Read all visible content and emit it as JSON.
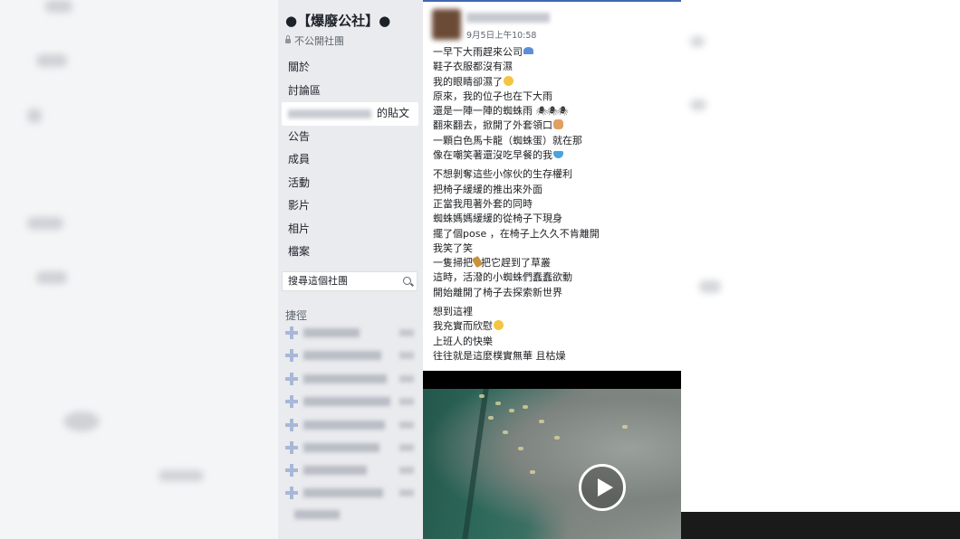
{
  "group": {
    "title": "●【爆廢公社】●",
    "privacy": "不公開社團"
  },
  "sidebar": {
    "items": [
      {
        "label": "關於"
      },
      {
        "label": "討論區"
      },
      {
        "label": "的貼文"
      },
      {
        "label": "公告"
      },
      {
        "label": "成員"
      },
      {
        "label": "活動"
      },
      {
        "label": "影片"
      },
      {
        "label": "相片"
      },
      {
        "label": "檔案"
      }
    ],
    "search_placeholder": "搜尋這個社團",
    "shortcuts_label": "捷徑"
  },
  "post": {
    "timestamp": "9月5日上午10:58",
    "paragraphs": [
      [
        "一早下大雨趕來公司",
        "鞋子衣服都沒有濕",
        "我的眼睛卻濕了",
        "原來，我的位子也在下大雨",
        "還是一陣一陣的蜘蛛雨",
        "翻來翻去，掀開了外套領口",
        "一顆白色馬卡龍（蜘蛛蛋）就在那",
        "像在嘲笑著還沒吃早餐的我"
      ],
      [
        "不想剝奪這些小傢伙的生存權利",
        "把椅子緩緩的推出來外面",
        "正當我甩著外套的同時",
        "蜘蛛媽媽緩緩的從椅子下現身",
        "擺了個pose ，在椅子上久久不肯離開",
        "我笑了笑",
        "一隻掃把",
        "把它趕到了草叢",
        "這時，活潑的小蜘蛛們蠢蠢欲動",
        "開始離開了椅子去探索新世界"
      ],
      [
        "想到這裡",
        "我充實而欣慰",
        "上班人的快樂",
        "往往就是這麼樸實無華 且枯燥"
      ]
    ],
    "emoji": [
      "umbrella",
      "crying-face",
      "spider",
      "raised-hand",
      "bowl",
      "broom",
      "smiling-face"
    ]
  },
  "colors": {
    "facebook_blue": "#4267b2",
    "sidebar_bg": "#e9ebee",
    "video_green": "#2e6a5c"
  }
}
